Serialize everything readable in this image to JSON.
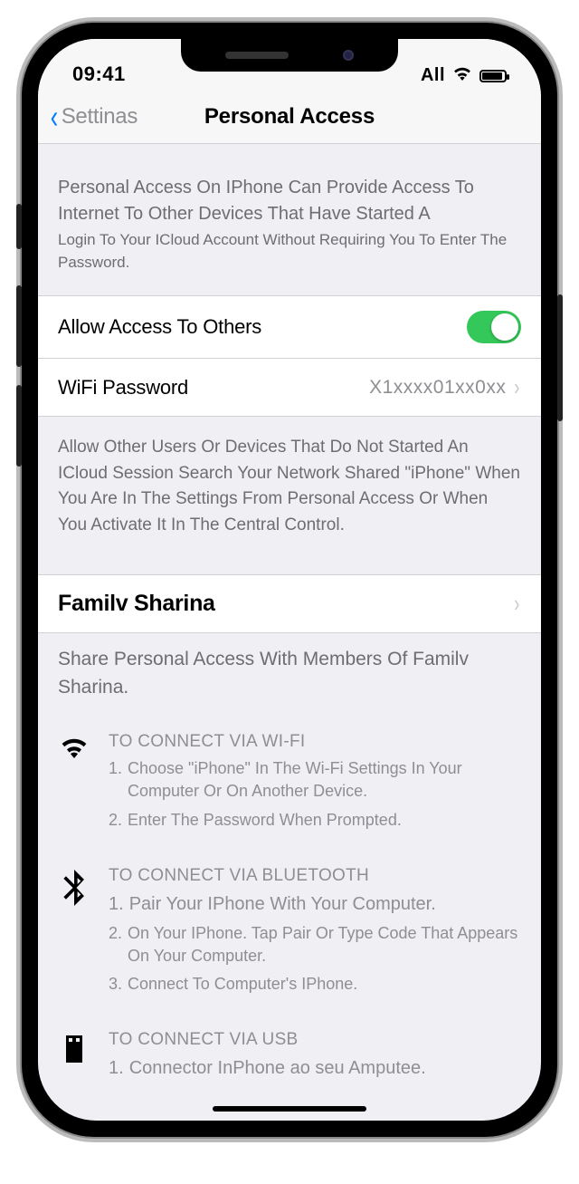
{
  "status": {
    "time": "09:41",
    "carrier": "All"
  },
  "nav": {
    "back": "Settinas",
    "title": "Personal Access"
  },
  "header": {
    "line1": "Personal Access On IPhone Can Provide Access To Internet To Other Devices That Have Started A",
    "line2": "Login To Your ICloud Account Without Requiring You To Enter The Password."
  },
  "rows": {
    "allow_label": "Allow Access To Others",
    "wifi_label": "WiFi Password",
    "wifi_value": "X1xxxx01xx0xx"
  },
  "footer1": "Allow Other Users Or Devices That Do Not Started An ICloud Session Search Your Network Shared \"iPhone\" When You Are In The Settings From Personal Access Or When You Activate It In The Central Control.",
  "family": {
    "label": "Familv Sharina",
    "desc": "Share Personal Access With Members Of Familv Sharina."
  },
  "instructions": {
    "wifi": {
      "title": "TO CONNECT VIA WI-FI",
      "s1": "Choose \"iPhone\" In The Wi-Fi Settings In Your Computer Or On Another Device.",
      "s2": "Enter The Password When Prompted."
    },
    "bt": {
      "title": "TO CONNECT VIA BLUETOOTH",
      "s1": "Pair Your IPhone With Your Computer.",
      "s2": "On Your IPhone. Tap Pair Or Type Code That Appears On Your Computer.",
      "s3": "Connect To Computer's IPhone."
    },
    "usb": {
      "title": "TO CONNECT VIA USB",
      "s1": "Connector InPhone ao seu Amputee."
    }
  }
}
